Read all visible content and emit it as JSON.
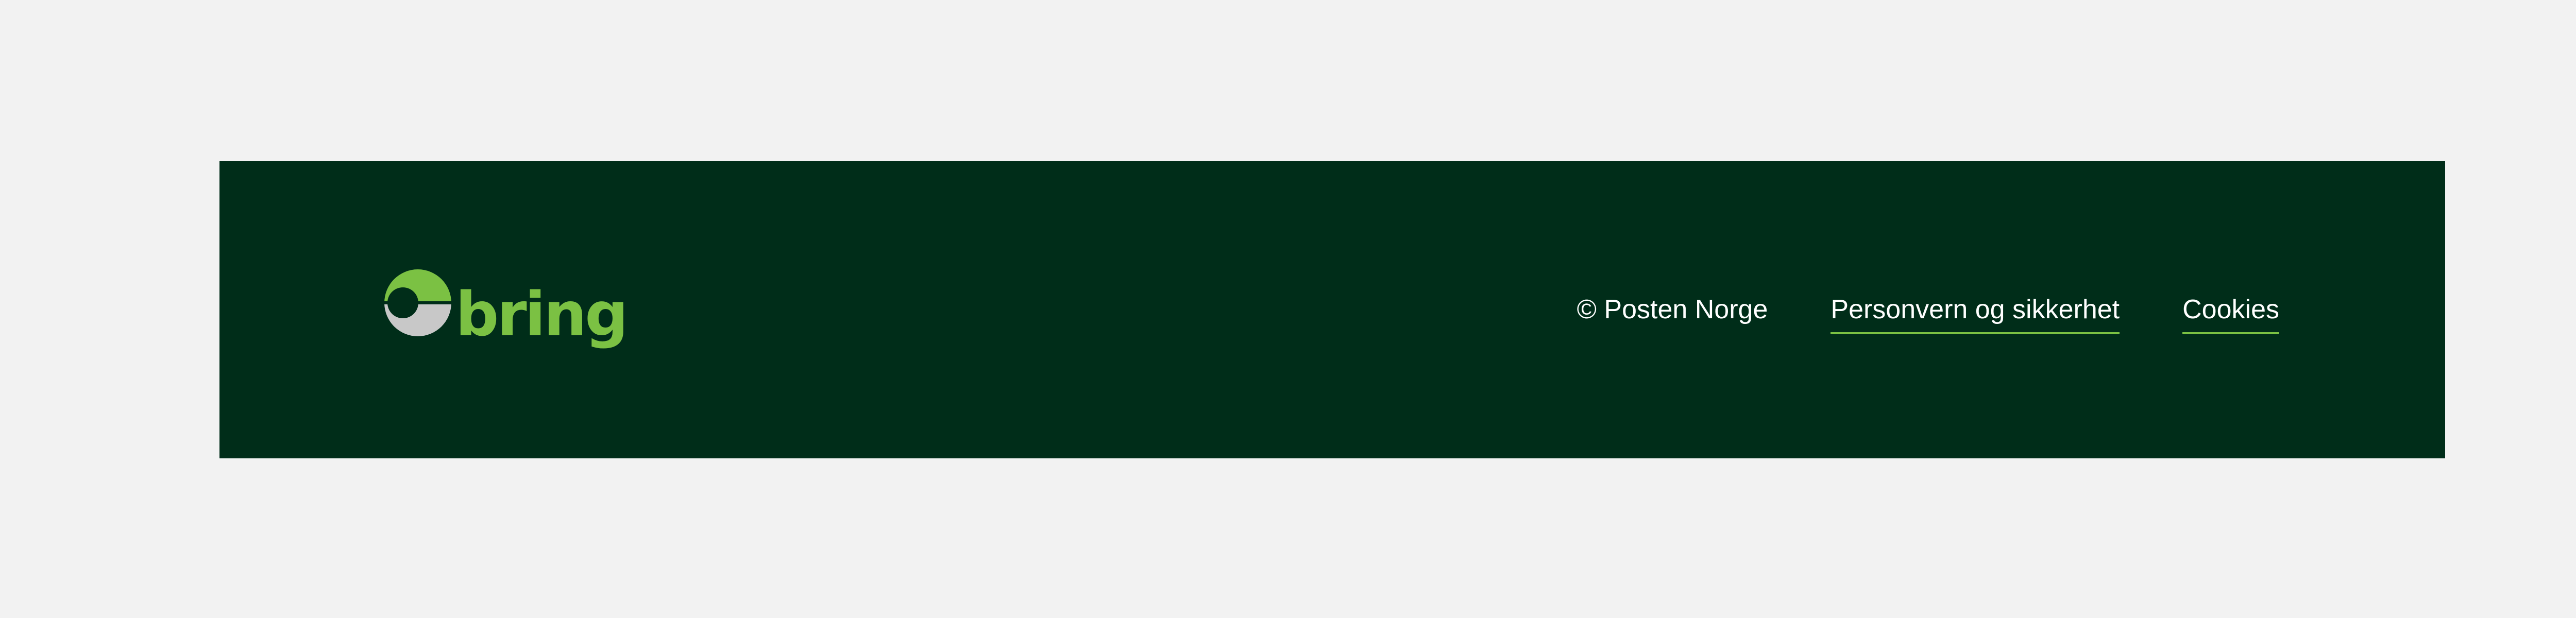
{
  "footer": {
    "logo": {
      "icon": "bring-logo-icon",
      "wordmark": "bring",
      "colors": {
        "green": "#7bc143",
        "grey": "#c8c8c8"
      }
    },
    "copyright": "© Posten Norge",
    "links": [
      {
        "label": "Personvern og sikkerhet"
      },
      {
        "label": "Cookies"
      }
    ],
    "colors": {
      "background": "#002d19",
      "page_background": "#f2f2f2",
      "link_underline": "#7bc143",
      "text": "#ffffff"
    }
  }
}
